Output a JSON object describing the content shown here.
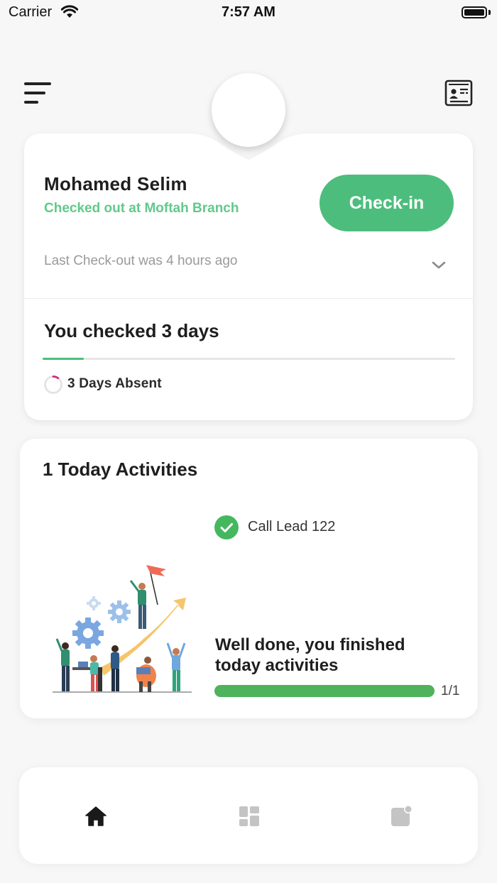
{
  "status_bar": {
    "carrier": "Carrier",
    "time": "7:57 AM"
  },
  "header": {
    "menu_icon": "menu-lines-icon",
    "card_icon": "id-card-icon"
  },
  "profile": {
    "name": "Mohamed Selim",
    "status": "Checked out at Moftah Branch",
    "checkin_label": "Check-in",
    "last_checkout": "Last Check-out was 4 hours ago"
  },
  "attendance": {
    "title": "You checked 3 days",
    "progress_fraction": 0.1,
    "absent_label": "3 Days Absent"
  },
  "activities": {
    "title": "1 Today Activities",
    "items": [
      {
        "label": "Call Lead 122",
        "done": true
      }
    ],
    "done_message": "Well done, you finished today activities",
    "progress_fraction": 1.0,
    "count": "1/1"
  },
  "bottom_nav": {
    "items": [
      {
        "icon": "home-icon",
        "active": true
      },
      {
        "icon": "dashboard-icon",
        "active": false
      },
      {
        "icon": "notification-icon",
        "active": false
      }
    ]
  },
  "colors": {
    "accent_green": "#4dbd7d",
    "status_green": "#62c98a",
    "progress_green": "#4fb25c",
    "absent_pink": "#d4297a"
  }
}
